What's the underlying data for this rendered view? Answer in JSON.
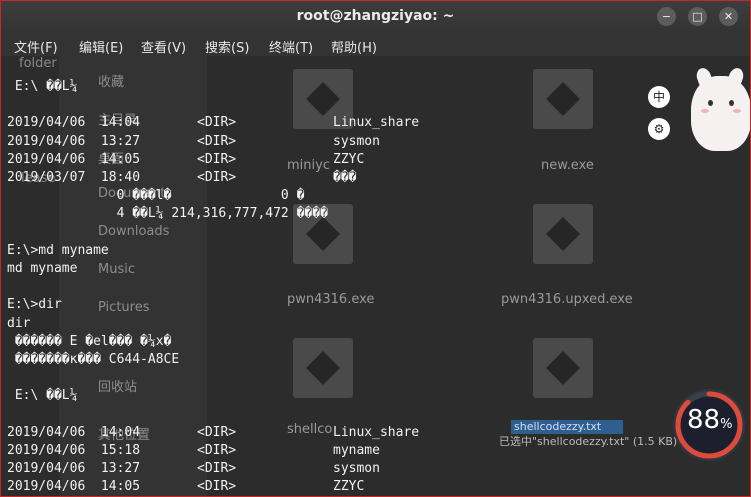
{
  "window": {
    "title": "root@zhangziyao: ~",
    "controls": {
      "minimize": "−",
      "maximize": "□",
      "close": "✕"
    }
  },
  "menu": [
    "文件(F)",
    "编辑(E)",
    "查看(V)",
    "搜索(S)",
    "终端(T)",
    "帮助(H)"
  ],
  "background": {
    "folder_text": "folder",
    "sidebar": [
      "收藏",
      "主目录",
      "桌面",
      "Documents",
      "Downloads",
      "Music",
      "Pictures",
      "回收站",
      "其他位置"
    ],
    "stray_text": "lease",
    "files": [
      "miniyc",
      "new.exe",
      "pwn4316.exe",
      "pwn4316.upxed.exe",
      "shellco"
    ],
    "selected_file": "shellcodezzy.txt",
    "status": "已选中\"shellcodezzy.txt\" (1.5 KB)"
  },
  "terminal": {
    "lines": [
      " E:\\ ��L¼",
      "",
      [
        "2019/04/06  14:04",
        "<DIR>",
        "Linux_share"
      ],
      [
        "2019/04/06  13:27",
        "<DIR>",
        "sysmon"
      ],
      [
        "2019/04/06  14:05",
        "<DIR>",
        "ZZYC"
      ],
      [
        "2019/03/07  18:40",
        "<DIR>",
        "���"
      ],
      "              0 ���l�              0 �",
      "              4 ��L¼ 214,316,777,472 ����",
      "",
      "E:\\>md myname",
      "md myname",
      "",
      "E:\\>dir",
      "dir",
      " ������ E �el��� �¼x�",
      " �������к��� C644-A8CE",
      "",
      " E:\\ ��L¼",
      "",
      [
        "2019/04/06  14:04",
        "<DIR>",
        "Linux_share"
      ],
      [
        "2019/04/06  15:18",
        "<DIR>",
        "myname"
      ],
      [
        "2019/04/06  13:27",
        "<DIR>",
        "sysmon"
      ],
      [
        "2019/04/06  14:05",
        "<DIR>",
        "ZZYC"
      ]
    ]
  },
  "widgets": {
    "cpu_percent": "88",
    "cpu_unit": "%",
    "cpu_level": 0.88,
    "ime_lang": "中",
    "ime_settings_icon": "gear-icon"
  }
}
